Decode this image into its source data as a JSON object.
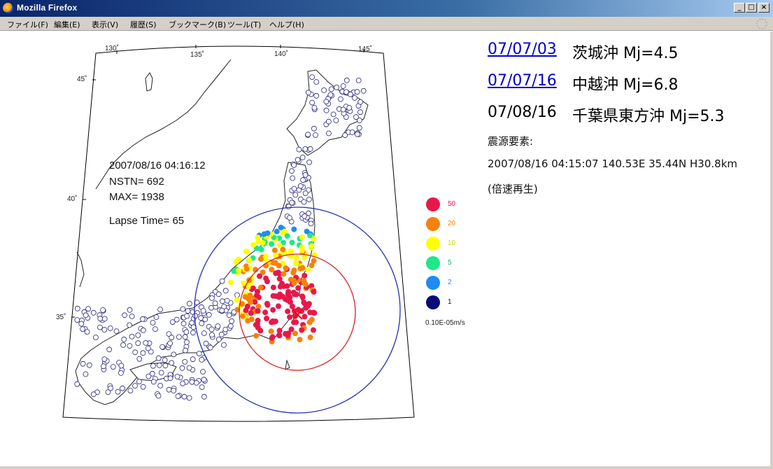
{
  "window": {
    "title": "Mozilla Firefox",
    "controls": {
      "minimize": "_",
      "maximize": "□",
      "close": "×"
    }
  },
  "menu": [
    "ファイル(F)",
    "編集(E)",
    "表示(V)",
    "履歴(S)",
    "ブックマーク(B)",
    "ツール(T)",
    "ヘルプ(H)"
  ],
  "map": {
    "overlay": {
      "time": "2007/08/16 04:16:12",
      "nstn": "NSTN=  692",
      "max": "MAX=  1938",
      "lapse": "Lapse Time=  65"
    },
    "lon_labels": [
      "130˚",
      "135˚",
      "140˚",
      "145˚"
    ],
    "lat_labels": [
      "45˚",
      "40˚",
      "35˚"
    ]
  },
  "legend": {
    "items": [
      {
        "label": "50",
        "color": "#e8174a"
      },
      {
        "label": "20",
        "color": "#f5820d"
      },
      {
        "label": "10",
        "color": "#ffff00"
      },
      {
        "label": "5",
        "color": "#1ee888"
      },
      {
        "label": "2",
        "color": "#1e8cf0"
      },
      {
        "label": "1",
        "color": "#0a0a78"
      }
    ],
    "unit": "0.10E-05m/s"
  },
  "events": [
    {
      "date": "07/07/03",
      "desc": "茨城沖 Mj=4.5",
      "link": true
    },
    {
      "date": "07/07/16",
      "desc": "中越沖 Mj=6.8",
      "link": true
    },
    {
      "date": "07/08/16",
      "desc": "千葉県東方沖 Mj=5.3",
      "link": false
    }
  ],
  "hypocenter_label": "震源要素:",
  "hypocenter_value": "2007/08/16 04:15:07 140.53E 35.44N H30.8km",
  "speed_note": "(倍速再生)"
}
